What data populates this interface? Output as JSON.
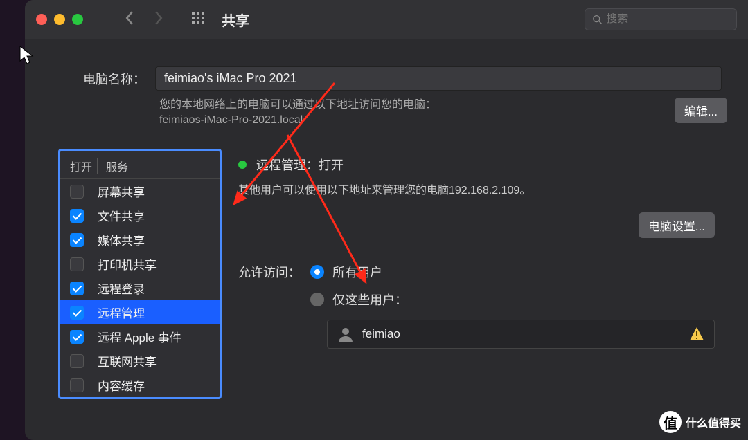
{
  "toolbar": {
    "title": "共享",
    "search_placeholder": "搜索"
  },
  "computer_name": {
    "label": "电脑名称：",
    "value": "feimiao's iMac Pro 2021",
    "desc1": "您的本地网络上的电脑可以通过以下地址访问您的电脑：",
    "desc2": "feimiaos-iMac-Pro-2021.local",
    "edit_btn": "编辑..."
  },
  "services": {
    "head_open": "打开",
    "head_svc": "服务",
    "items": [
      {
        "label": "屏幕共享",
        "checked": false
      },
      {
        "label": "文件共享",
        "checked": true
      },
      {
        "label": "媒体共享",
        "checked": true
      },
      {
        "label": "打印机共享",
        "checked": false
      },
      {
        "label": "远程登录",
        "checked": true
      },
      {
        "label": "远程管理",
        "checked": true,
        "selected": true
      },
      {
        "label": "远程 Apple 事件",
        "checked": true
      },
      {
        "label": "互联网共享",
        "checked": false
      },
      {
        "label": "内容缓存",
        "checked": false
      }
    ]
  },
  "detail": {
    "status": "远程管理：打开",
    "desc": "其他用户可以使用以下地址来管理您的电脑192.168.2.109。",
    "settings_btn": "电脑设置...",
    "access_label": "允许访问：",
    "radio_all": "所有用户",
    "radio_only": "仅这些用户：",
    "users": [
      {
        "name": "feimiao"
      }
    ]
  },
  "watermark": {
    "glyph": "值",
    "text": "什么值得买"
  }
}
